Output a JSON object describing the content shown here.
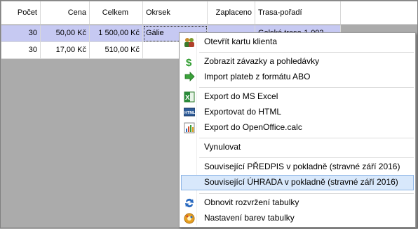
{
  "table": {
    "headers": [
      "Počet",
      "Cena",
      "Celkem",
      "Okrsek",
      "Zaplaceno",
      "Trasa-pořadí"
    ],
    "rows": [
      {
        "pocet": "30",
        "cena": "50,00 Kč",
        "celkem": "1 500,00 Kč",
        "okrsek": "Gálie",
        "zaplaceno": "",
        "trasa": "Galská trasa-1-002"
      },
      {
        "pocet": "30",
        "cena": "17,00 Kč",
        "celkem": "510,00 Kč",
        "okrsek": "",
        "zaplaceno": "",
        "trasa": ""
      }
    ]
  },
  "menu": {
    "items": [
      {
        "label": "Otevřít kartu klienta",
        "icon": "client-card-icon"
      },
      {
        "label": "Zobrazit závazky a pohledávky",
        "icon": "dollar-icon"
      },
      {
        "label": "Import plateb z formátu ABO",
        "icon": "import-arrow-icon"
      },
      {
        "label": "Export do MS Excel",
        "icon": "excel-icon"
      },
      {
        "label": "Exportovat do HTML",
        "icon": "html-icon"
      },
      {
        "label": "Export do OpenOffice.calc",
        "icon": "calc-chart-icon"
      },
      {
        "label": "Vynulovat",
        "icon": ""
      },
      {
        "label": "Související PŘEDPIS v pokladně (stravné září 2016)",
        "icon": ""
      },
      {
        "label": "Související ÚHRADA v pokladně (stravné září 2016)",
        "icon": ""
      },
      {
        "label": "Obnovit rozvržení tabulky",
        "icon": "refresh-icon"
      },
      {
        "label": "Nastavení barev tabulky",
        "icon": "color-settings-icon"
      }
    ]
  },
  "colors": {
    "selection": "#c6c9f2",
    "menu_hover": "#d8e8fb",
    "background": "#ababab"
  }
}
